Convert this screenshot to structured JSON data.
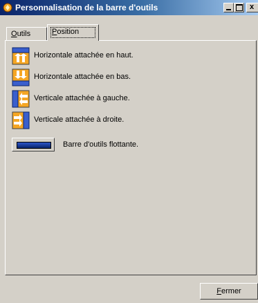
{
  "window": {
    "title": "Personnalisation de la barre d'outils",
    "close_glyph": "x"
  },
  "tabs": [
    {
      "mnemonic": "O",
      "rest": "utils",
      "selected": false
    },
    {
      "mnemonic": "P",
      "rest": "osition",
      "selected": true
    }
  ],
  "options": [
    {
      "label": "Horizontale attachée en haut.",
      "icon": "dock-top-icon"
    },
    {
      "label": "Horizontale attachée en bas.",
      "icon": "dock-bottom-icon"
    },
    {
      "label": "Verticale attachée à gauche.",
      "icon": "dock-left-icon"
    },
    {
      "label": "Verticale attachée à droite.",
      "icon": "dock-right-icon"
    }
  ],
  "floating": {
    "label": "Barre d'outils flottante.",
    "icon": "floating-toolbar-icon"
  },
  "footer": {
    "close_mnemonic": "F",
    "close_rest": "ermer"
  },
  "colors": {
    "title_start": "#0a246a",
    "title_end": "#a6caf0",
    "face": "#d4d0c8",
    "icon_orange": "#f5a623",
    "icon_blue": "#0a246a"
  }
}
